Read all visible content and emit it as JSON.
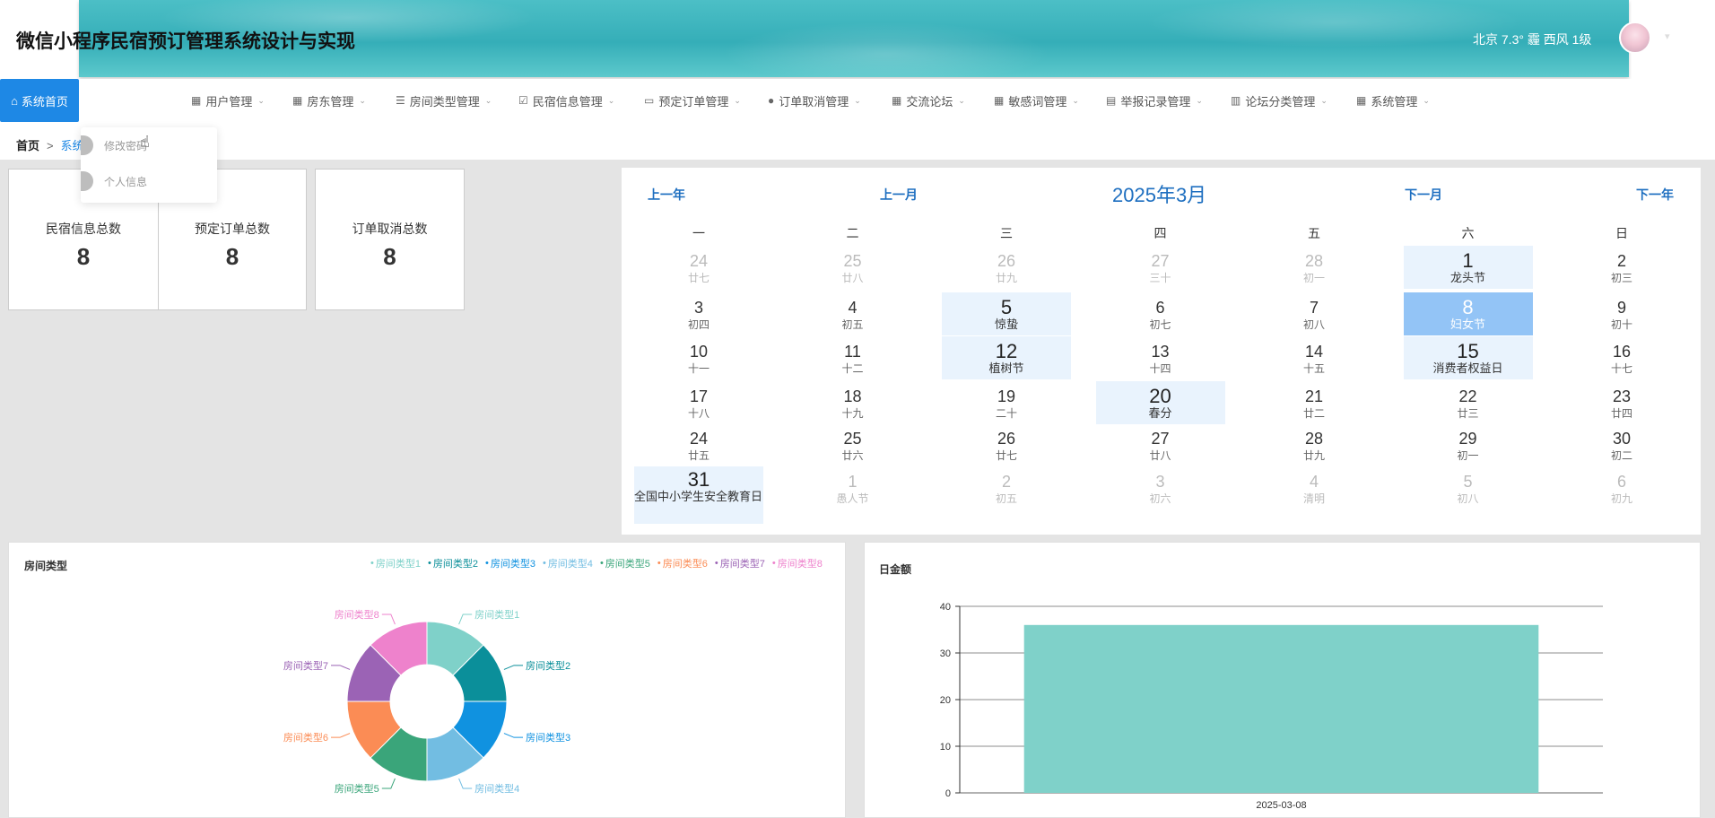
{
  "header": {
    "title": "微信小程序民宿预订管理系统设计与实现",
    "weather": "北京  7.3°  霾  西风  1级"
  },
  "nav": {
    "home": "系统首页",
    "items": [
      {
        "label": "用户管理",
        "icon": "grid-icon"
      },
      {
        "label": "房东管理",
        "icon": "grid-icon"
      },
      {
        "label": "房间类型管理",
        "icon": "list-icon"
      },
      {
        "label": "民宿信息管理",
        "icon": "check-square-icon"
      },
      {
        "label": "预定订单管理",
        "icon": "monitor-icon"
      },
      {
        "label": "订单取消管理",
        "icon": "user-icon"
      },
      {
        "label": "交流论坛",
        "icon": "grid-icon"
      },
      {
        "label": "敏感词管理",
        "icon": "grid-icon"
      },
      {
        "label": "举报记录管理",
        "icon": "clipboard-icon"
      },
      {
        "label": "论坛分类管理",
        "icon": "bar-chart-icon"
      },
      {
        "label": "系统管理",
        "icon": "grid-icon"
      }
    ]
  },
  "breadcrumb": {
    "home": "首页",
    "sep": ">",
    "current": "系统"
  },
  "dropdown": {
    "items": [
      "修改密码",
      "个人信息"
    ]
  },
  "stats": [
    {
      "label": "民宿信息总数",
      "value": "8"
    },
    {
      "label": "预定订单总数",
      "value": "8"
    },
    {
      "label": "订单取消总数",
      "value": "8"
    }
  ],
  "calendar": {
    "prev_year": "上一年",
    "prev_month": "上一月",
    "title": "2025年3月",
    "next_month": "下一月",
    "next_year": "下一年",
    "weekdays": [
      "一",
      "二",
      "三",
      "四",
      "五",
      "六",
      "日"
    ],
    "weeks": [
      [
        {
          "d": "24",
          "l": "廿七",
          "o": true
        },
        {
          "d": "25",
          "l": "廿八",
          "o": true
        },
        {
          "d": "26",
          "l": "廿九",
          "o": true
        },
        {
          "d": "27",
          "l": "三十",
          "o": true
        },
        {
          "d": "28",
          "l": "初一",
          "o": true
        },
        {
          "d": "1",
          "l": "龙头节",
          "f": true
        },
        {
          "d": "2",
          "l": "初三"
        }
      ],
      [
        {
          "d": "3",
          "l": "初四"
        },
        {
          "d": "4",
          "l": "初五"
        },
        {
          "d": "5",
          "l": "惊蛰",
          "f": true
        },
        {
          "d": "6",
          "l": "初七"
        },
        {
          "d": "7",
          "l": "初八"
        },
        {
          "d": "8",
          "l": "妇女节",
          "s": true
        },
        {
          "d": "9",
          "l": "初十"
        }
      ],
      [
        {
          "d": "10",
          "l": "十一"
        },
        {
          "d": "11",
          "l": "十二"
        },
        {
          "d": "12",
          "l": "植树节",
          "f": true
        },
        {
          "d": "13",
          "l": "十四"
        },
        {
          "d": "14",
          "l": "十五"
        },
        {
          "d": "15",
          "l": "消费者权益日",
          "f": true
        },
        {
          "d": "16",
          "l": "十七"
        }
      ],
      [
        {
          "d": "17",
          "l": "十八"
        },
        {
          "d": "18",
          "l": "十九"
        },
        {
          "d": "19",
          "l": "二十"
        },
        {
          "d": "20",
          "l": "春分",
          "f": true
        },
        {
          "d": "21",
          "l": "廿二"
        },
        {
          "d": "22",
          "l": "廿三"
        },
        {
          "d": "23",
          "l": "廿四"
        }
      ],
      [
        {
          "d": "24",
          "l": "廿五"
        },
        {
          "d": "25",
          "l": "廿六"
        },
        {
          "d": "26",
          "l": "廿七"
        },
        {
          "d": "27",
          "l": "廿八"
        },
        {
          "d": "28",
          "l": "廿九"
        },
        {
          "d": "29",
          "l": "初一"
        },
        {
          "d": "30",
          "l": "初二"
        }
      ],
      [
        {
          "d": "31",
          "l": "全国中小学生安全教育日",
          "f": true
        },
        {
          "d": "1",
          "l": "愚人节",
          "o": true
        },
        {
          "d": "2",
          "l": "初五",
          "o": true
        },
        {
          "d": "3",
          "l": "初六",
          "o": true
        },
        {
          "d": "4",
          "l": "清明",
          "o": true
        },
        {
          "d": "5",
          "l": "初八",
          "o": true
        },
        {
          "d": "6",
          "l": "初九",
          "o": true
        }
      ]
    ]
  },
  "room_chart_title": "房间类型",
  "amount_chart_title": "日金额",
  "colors": {
    "accent": "#1e88e5",
    "calendar_blue": "#1e6fc0",
    "highlight": "#e9f3fd",
    "selected": "#93c4f6",
    "bar": "#7fd1c9"
  },
  "chart_data": [
    {
      "type": "pie",
      "title": "房间类型",
      "categories": [
        "房间类型1",
        "房间类型2",
        "房间类型3",
        "房间类型4",
        "房间类型5",
        "房间类型6",
        "房间类型7",
        "房间类型8"
      ],
      "values": [
        1,
        1,
        1,
        1,
        1,
        1,
        1,
        1
      ],
      "colors": [
        "#7fd1c9",
        "#0b8f9a",
        "#1092e0",
        "#72bde2",
        "#3aa57a",
        "#fb8c55",
        "#9b63b5",
        "#ee82cc"
      ],
      "legend": "top-right",
      "donut": true
    },
    {
      "type": "bar",
      "title": "日金额",
      "categories": [
        "2025-03-08"
      ],
      "values": [
        36
      ],
      "ylim": [
        0,
        40
      ],
      "yticks": [
        0,
        10,
        20,
        30,
        40
      ],
      "grid": true,
      "color": "#7fd1c9"
    }
  ]
}
